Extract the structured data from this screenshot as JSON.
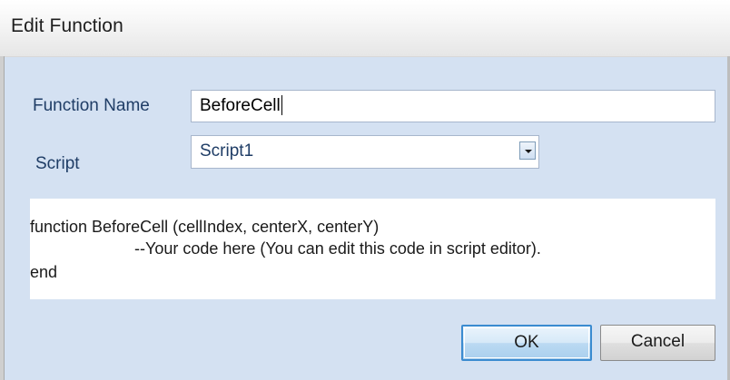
{
  "window": {
    "title": "Edit Function"
  },
  "form": {
    "function_name_label": "Function Name",
    "function_name_value": "BeforeCell",
    "script_label": "Script",
    "script_selected": "Script1"
  },
  "code": {
    "lines": [
      "function BeforeCell (cellIndex, centerX, centerY)",
      "--Your code here (You can edit this code in script editor).",
      "end"
    ]
  },
  "buttons": {
    "ok_label": "OK",
    "cancel_label": "Cancel"
  },
  "icons": {
    "dropdown": "chevron-down-icon"
  },
  "colors": {
    "client_background": "#d4e1f2",
    "label_text": "#1f3d66",
    "default_button_border": "#3b8bd0"
  }
}
